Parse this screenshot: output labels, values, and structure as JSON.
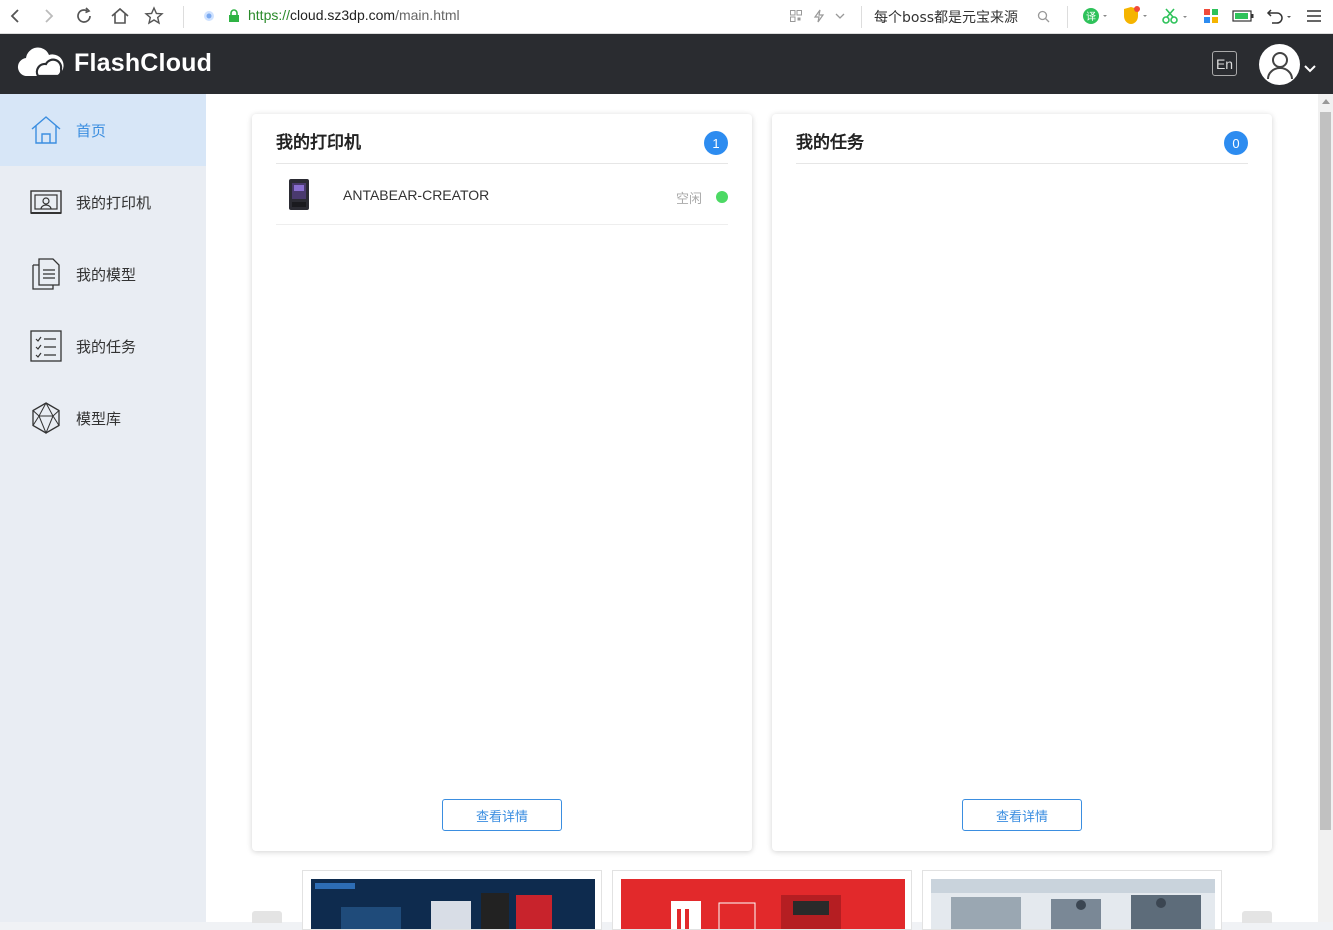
{
  "browser": {
    "url_scheme": "https://",
    "url_host": "cloud.sz3dp.com",
    "url_path": "/main.html",
    "search_hint": "每个boss都是元宝来源"
  },
  "header": {
    "app_name": "FlashCloud",
    "lang_label": "En"
  },
  "sidebar": {
    "items": [
      {
        "label": "首页",
        "icon": "home-icon",
        "active": true
      },
      {
        "label": "我的打印机",
        "icon": "printer-icon",
        "active": false
      },
      {
        "label": "我的模型",
        "icon": "document-icon",
        "active": false
      },
      {
        "label": "我的任务",
        "icon": "task-list-icon",
        "active": false
      },
      {
        "label": "模型库",
        "icon": "model-library-icon",
        "active": false
      }
    ]
  },
  "cards": {
    "printers": {
      "title": "我的打印机",
      "count": "1",
      "items": [
        {
          "name": "ANTABEAR-CREATOR",
          "status": "空闲"
        }
      ],
      "detail_label": "查看详情"
    },
    "tasks": {
      "title": "我的任务",
      "count": "0",
      "detail_label": "查看详情"
    }
  },
  "colors": {
    "accent": "#2d8cf0",
    "appbar": "#2a2c30",
    "sidebar_bg": "#e9edf3",
    "active_bg": "#d7e6f7",
    "status_idle": "#4cd964"
  }
}
